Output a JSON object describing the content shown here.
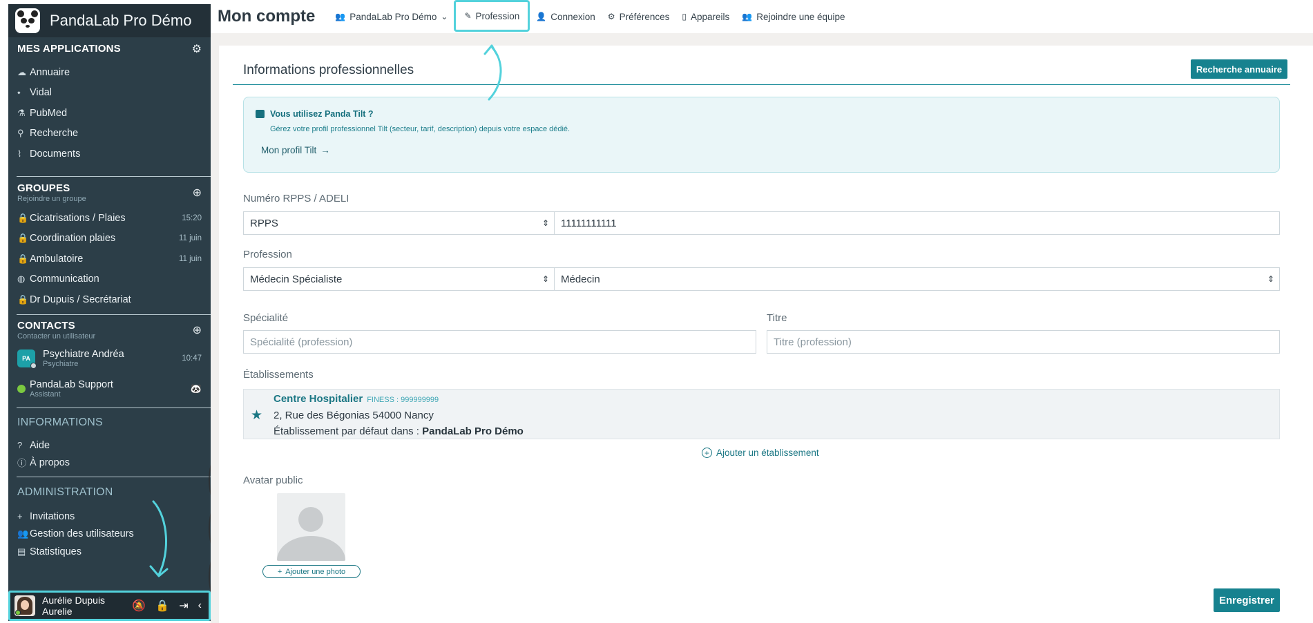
{
  "app": {
    "name": "PandaLab Pro Démo"
  },
  "sidebar": {
    "apps": {
      "title": "MES APPLICATIONS",
      "items": [
        {
          "icon": "cloud-icon",
          "glyph": "☁",
          "label": "Annuaire"
        },
        {
          "icon": "pill-icon",
          "glyph": "⬩",
          "label": "Vidal"
        },
        {
          "icon": "flask-icon",
          "glyph": "⚗",
          "label": "PubMed"
        },
        {
          "icon": "search-icon",
          "glyph": "⚲",
          "label": "Recherche"
        },
        {
          "icon": "paperclip-icon",
          "glyph": "⌇",
          "label": "Documents"
        }
      ]
    },
    "groups": {
      "title": "GROUPES",
      "subtitle": "Rejoindre un groupe",
      "items": [
        {
          "icon": "lock-icon",
          "label": "Cicatrisations / Plaies",
          "time": "15:20"
        },
        {
          "icon": "lock-icon",
          "label": "Coordination plaies",
          "time": "11 juin"
        },
        {
          "icon": "lock-icon",
          "label": "Ambulatoire",
          "time": "11 juin"
        },
        {
          "icon": "globe-icon",
          "label": "Communication",
          "time": ""
        },
        {
          "icon": "lock-icon",
          "label": "Dr Dupuis / Secrétariat",
          "time": ""
        }
      ]
    },
    "contacts": {
      "title": "CONTACTS",
      "subtitle": "Contacter un utilisateur",
      "items": [
        {
          "initials": "PA",
          "name": "Psychiatre Andréa",
          "role": "Psychiatre",
          "time": "10:47"
        },
        {
          "name": "PandaLab Support",
          "role": "Assistant"
        }
      ]
    },
    "informations": {
      "title": "INFORMATIONS",
      "items": [
        {
          "glyph": "?",
          "label": "Aide"
        },
        {
          "glyph": "ⓘ",
          "label": "À propos"
        }
      ]
    },
    "administration": {
      "title": "ADMINISTRATION",
      "items": [
        {
          "glyph": "+",
          "label": "Invitations"
        },
        {
          "glyph": "👥",
          "label": "Gestion des utilisateurs"
        },
        {
          "glyph": "▤",
          "label": "Statistiques"
        }
      ]
    },
    "user": {
      "name": "Aurélie Dupuis",
      "username": "Aurelie"
    }
  },
  "topbar": {
    "title": "Mon compte",
    "tabs": [
      {
        "icon": "team-icon",
        "label": "PandaLab Pro Démo",
        "dropdown": true
      },
      {
        "icon": "pen-icon",
        "label": "Profession",
        "active": true
      },
      {
        "icon": "user-icon",
        "label": "Connexion"
      },
      {
        "icon": "gear-icon",
        "label": "Préférences"
      },
      {
        "icon": "phone-icon",
        "label": "Appareils"
      },
      {
        "icon": "join-team-icon",
        "label": "Rejoindre une équipe"
      }
    ]
  },
  "main": {
    "section_title": "Informations professionnelles",
    "search_button": "Recherche annuaire",
    "tilt": {
      "question": "Vous utilisez Panda Tilt ?",
      "description": "Gérez votre profil professionnel Tilt (secteur, tarif, description) depuis votre espace dédié.",
      "link": "Mon profil Tilt"
    },
    "rpps": {
      "label": "Numéro RPPS / ADELI",
      "type": "RPPS",
      "number": "11111111111"
    },
    "profession": {
      "label": "Profession",
      "category": "Médecin Spécialiste",
      "value": "Médecin"
    },
    "specialite": {
      "label": "Spécialité",
      "placeholder": "Spécialité (profession)"
    },
    "titre": {
      "label": "Titre",
      "placeholder": "Titre (profession)"
    },
    "etablissements": {
      "label": "Établissements",
      "items": [
        {
          "name": "Centre Hospitalier",
          "finess": "FINESS : 999999999",
          "address": "2, Rue des Bégonias 54000 Nancy",
          "default_prefix": "Établissement par défaut dans :",
          "default_team": "PandaLab Pro Démo"
        }
      ],
      "add_label": "Ajouter un établissement"
    },
    "avatar": {
      "label": "Avatar public",
      "add_photo": "Ajouter une photo"
    },
    "save_button": "Enregistrer"
  },
  "colors": {
    "sidebar_bg": "#2c3e48",
    "accent": "#17828f",
    "highlight": "#53d2dc"
  }
}
